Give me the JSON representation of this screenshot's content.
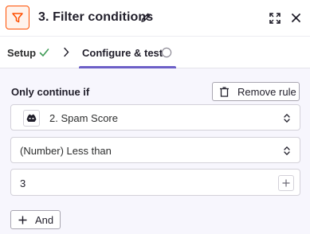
{
  "header": {
    "title": "3. Filter conditions",
    "step_icon": "filter-icon",
    "edit_icon": "pencil-icon",
    "expand_icon": "expand-icon",
    "close_icon": "close-icon"
  },
  "tabs": {
    "setup_label": "Setup",
    "setup_status_icon": "check-icon",
    "separator_icon": "chevron-right-icon",
    "configure_label": "Configure & test",
    "configure_status_icon": "circle-icon"
  },
  "rule": {
    "heading": "Only continue if",
    "remove_label": "Remove rule",
    "field": "2. Spam Score",
    "field_app_icon": "bot-icon",
    "operator": "(Number) Less than",
    "value": "3",
    "and_label": "And"
  },
  "colors": {
    "accent": "#ff4f00",
    "tab_active": "#6c5fc7",
    "success": "#3f9b56",
    "background": "#f7f6fd"
  }
}
